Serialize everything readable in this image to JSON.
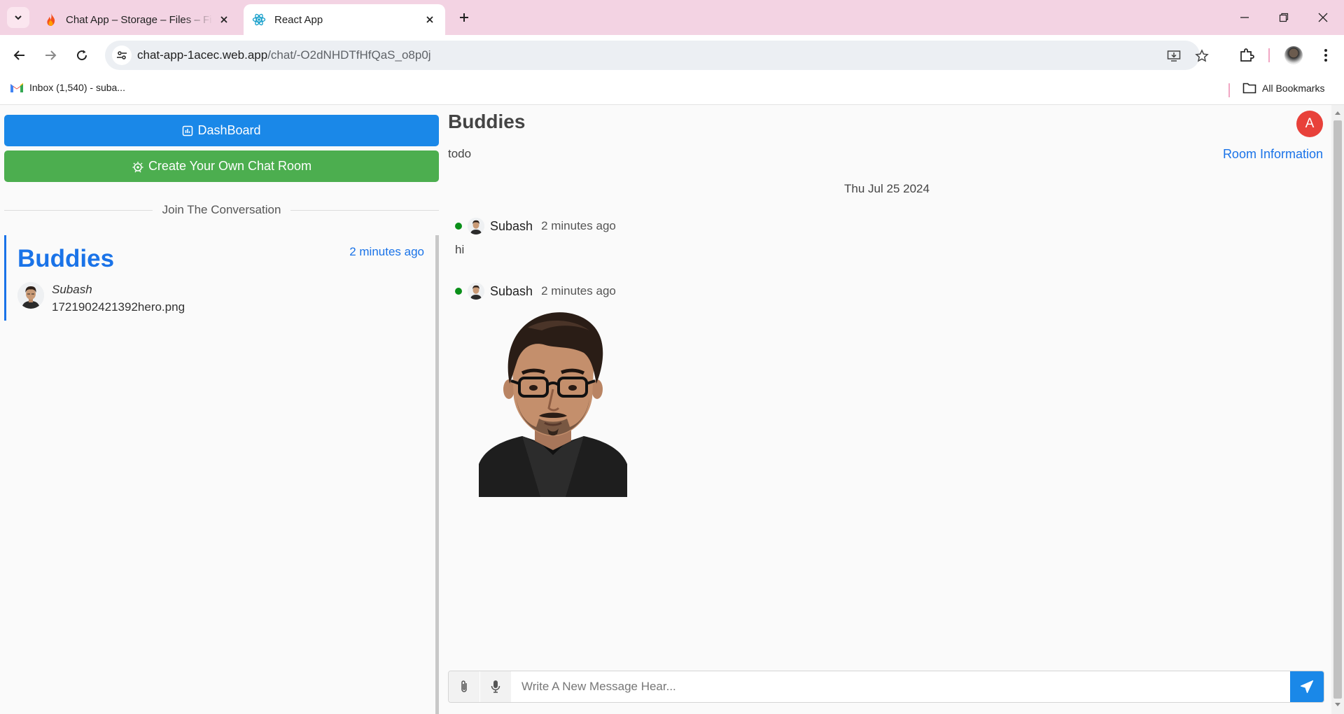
{
  "browser": {
    "tabs": [
      {
        "title": "Chat App – Storage – Files – Firebase",
        "favicon": "firebase-flame-icon",
        "active": false
      },
      {
        "title": "React App",
        "favicon": "react-atom-icon",
        "active": true
      }
    ],
    "url": {
      "host": "chat-app-1acec.web.app",
      "path": "/chat/-O2dNHDTfHfQaS_o8p0j"
    },
    "bookmarks": [
      {
        "label": "Inbox (1,540) - suba...",
        "icon": "gmail-icon"
      }
    ],
    "all_bookmarks_label": "All Bookmarks",
    "colors": {
      "tabbar": "#f3d3e3",
      "omnibox": "#eceff3"
    }
  },
  "sidebar": {
    "dashboard_label": "DashBoard",
    "create_room_label": "Create Your Own Chat Room",
    "join_label": "Join The Conversation",
    "rooms": [
      {
        "name": "Buddies",
        "time": "2 minutes ago",
        "author": "Subash",
        "last_message": "1721902421392hero.png"
      }
    ]
  },
  "chat": {
    "title": "Buddies",
    "description": "todo",
    "user_initial": "A",
    "room_info_label": "Room Information",
    "date_separator": "Thu Jul 25 2024",
    "messages": [
      {
        "author": "Subash",
        "time": "2 minutes ago",
        "text": "hi",
        "online": true
      },
      {
        "author": "Subash",
        "time": "2 minutes ago",
        "attachment": "image",
        "online": true
      }
    ],
    "composer_placeholder": "Write A New Message Hear..."
  },
  "colors": {
    "primary": "#1a88e8",
    "link": "#1a73e8",
    "success": "#4cae4f",
    "online": "#0a8f19",
    "avatar": "#e8413a"
  }
}
